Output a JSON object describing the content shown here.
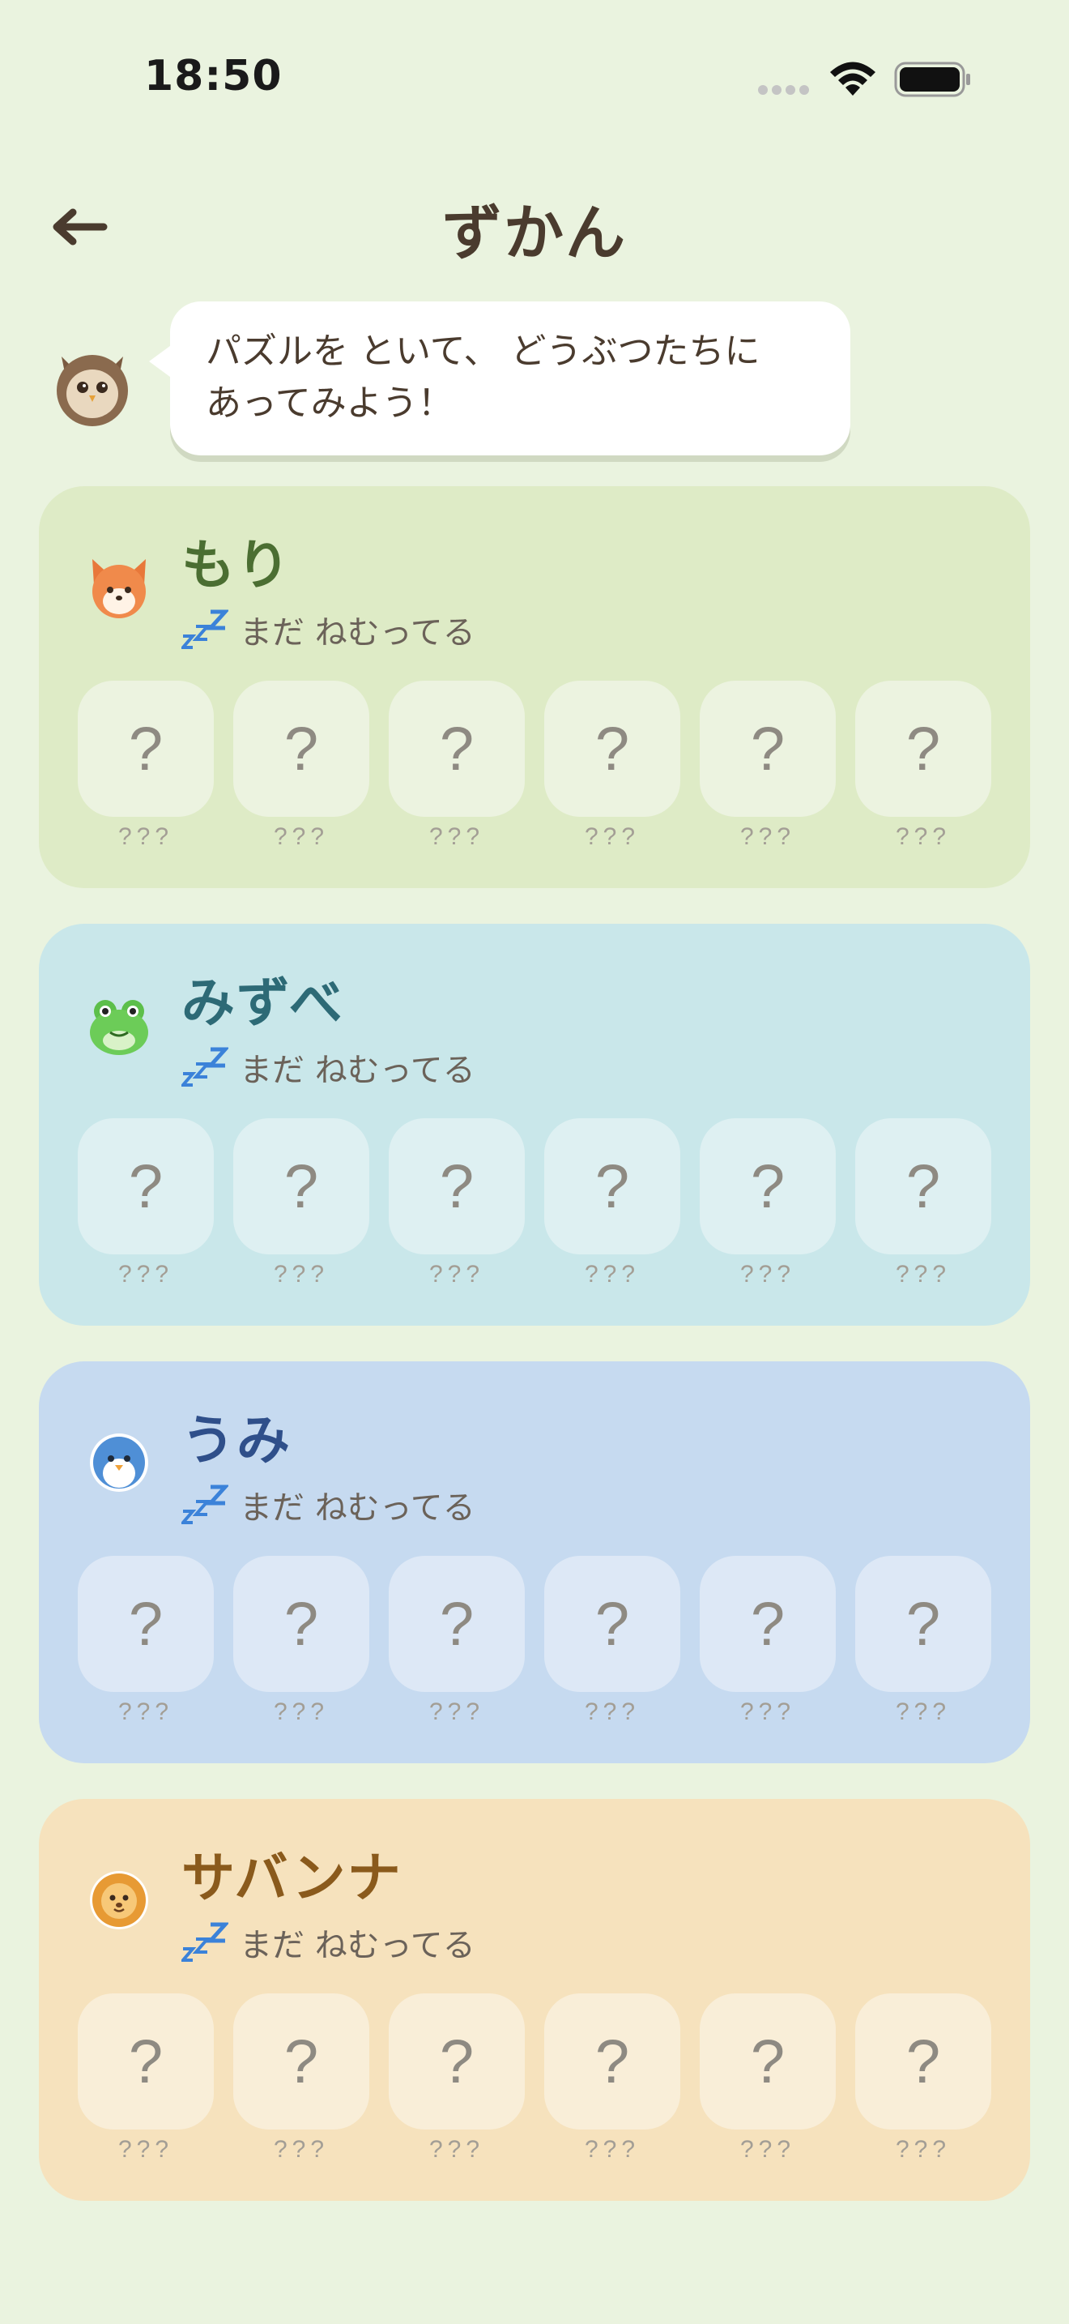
{
  "status_bar": {
    "time": "18:50"
  },
  "header": {
    "title": "ずかん"
  },
  "guide": {
    "line1": "パズルを といて、 どうぶつたちに",
    "line2": "あってみよう！"
  },
  "sections": [
    {
      "id": "mori",
      "title": "もり",
      "animal_icon": "fox-icon",
      "status": "まだ ねむってる",
      "colors": {
        "bg": "#deebc6",
        "tile": "#ecf3e0",
        "title": "#4b6e32"
      },
      "tiles": [
        {
          "mark": "?",
          "label": "???"
        },
        {
          "mark": "?",
          "label": "???"
        },
        {
          "mark": "?",
          "label": "???"
        },
        {
          "mark": "?",
          "label": "???"
        },
        {
          "mark": "?",
          "label": "???"
        },
        {
          "mark": "?",
          "label": "???"
        }
      ]
    },
    {
      "id": "mizube",
      "title": "みずべ",
      "animal_icon": "frog-icon",
      "status": "まだ ねむってる",
      "colors": {
        "bg": "#c9e7ea",
        "tile": "#def0f2",
        "title": "#2d6a76"
      },
      "tiles": [
        {
          "mark": "?",
          "label": "???"
        },
        {
          "mark": "?",
          "label": "???"
        },
        {
          "mark": "?",
          "label": "???"
        },
        {
          "mark": "?",
          "label": "???"
        },
        {
          "mark": "?",
          "label": "???"
        },
        {
          "mark": "?",
          "label": "???"
        }
      ]
    },
    {
      "id": "umi",
      "title": "うみ",
      "animal_icon": "penguin-icon",
      "status": "まだ ねむってる",
      "colors": {
        "bg": "#c6daf0",
        "tile": "#dde8f6",
        "title": "#2f4f8a"
      },
      "tiles": [
        {
          "mark": "?",
          "label": "???"
        },
        {
          "mark": "?",
          "label": "???"
        },
        {
          "mark": "?",
          "label": "???"
        },
        {
          "mark": "?",
          "label": "???"
        },
        {
          "mark": "?",
          "label": "???"
        },
        {
          "mark": "?",
          "label": "???"
        }
      ]
    },
    {
      "id": "savanna",
      "title": "サバンナ",
      "animal_icon": "lion-icon",
      "status": "まだ ねむってる",
      "colors": {
        "bg": "#f6e2bd",
        "tile": "#f9eed8",
        "title": "#8a5a1c"
      },
      "tiles": [
        {
          "mark": "?",
          "label": "???"
        },
        {
          "mark": "?",
          "label": "???"
        },
        {
          "mark": "?",
          "label": "???"
        },
        {
          "mark": "?",
          "label": "???"
        },
        {
          "mark": "?",
          "label": "???"
        },
        {
          "mark": "?",
          "label": "???"
        }
      ]
    }
  ]
}
